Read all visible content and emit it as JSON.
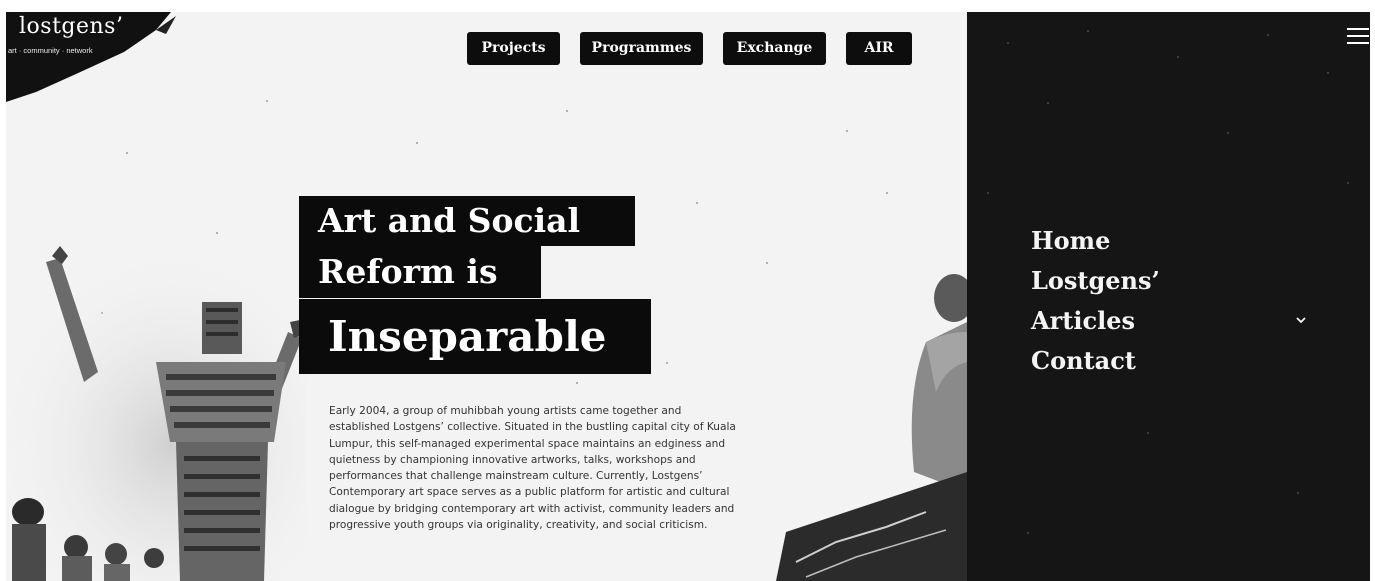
{
  "brand": {
    "name": "lostgens’",
    "tagline": "art · community · network"
  },
  "top_nav": [
    {
      "label": "Projects"
    },
    {
      "label": "Programmes"
    },
    {
      "label": "Exchange"
    },
    {
      "label": "AIR"
    }
  ],
  "hero": {
    "line1": "Art and Social",
    "line2": "Reform is",
    "line3": "Inseparable"
  },
  "intro": {
    "text": "Early 2004, a group of muhibbah young artists came together and established Lostgens’ collective. Situated in the bustling capital city of Kuala Lumpur, this self-managed experimental space maintains an edginess and quietness by championing innovative artworks, talks, workshops and performances that challenge mainstream culture. Currently, Lostgens’ Contemporary art space serves as a public platform for artistic and cultural dialogue by bridging contemporary art with activist, community leaders and progressive youth groups via originality, creativity, and social criticism."
  },
  "side_menu": {
    "items": [
      {
        "label": "Home"
      },
      {
        "label": "Lostgens’"
      },
      {
        "label": "Articles"
      },
      {
        "label": "Contact"
      }
    ]
  },
  "icons": {
    "menu": "hamburger-menu-icon",
    "articles_expand": "chevron-down-icon"
  },
  "colors": {
    "page_background": "#f3f3f3",
    "panel_background": "#151515",
    "button_background": "#0d0d0d",
    "button_text": "#ffffff"
  }
}
